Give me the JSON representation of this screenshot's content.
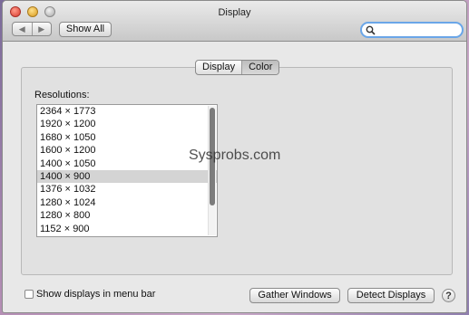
{
  "window": {
    "title": "Display"
  },
  "toolbar": {
    "back_icon": "back-arrow-icon",
    "forward_icon": "forward-arrow-icon",
    "show_all_label": "Show All",
    "search_placeholder": ""
  },
  "tabs": [
    {
      "label": "Display",
      "active": false
    },
    {
      "label": "Color",
      "active": true
    }
  ],
  "resolutions": {
    "label": "Resolutions:",
    "items": [
      "2364 × 1773",
      "1920 × 1200",
      "1680 × 1050",
      "1600 × 1200",
      "1400 × 1050",
      "1400 × 900",
      "1376 × 1032",
      "1280 × 1024",
      "1280 × 800",
      "1152 × 900"
    ],
    "selected_index": 5
  },
  "watermark": "Sysprobs.com",
  "footer": {
    "show_in_menu_bar_label": "Show displays in menu bar",
    "show_in_menu_bar_checked": false,
    "gather_windows_label": "Gather Windows",
    "detect_displays_label": "Detect Displays",
    "help_label": "?"
  }
}
